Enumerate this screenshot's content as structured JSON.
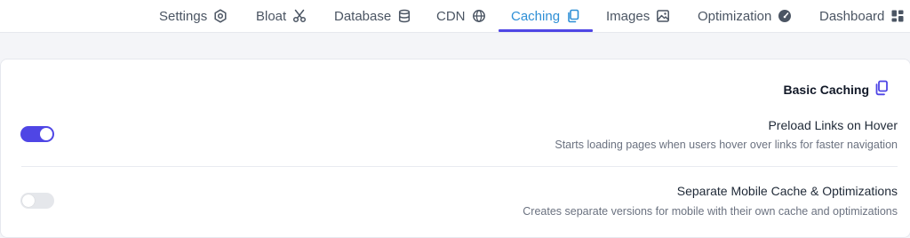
{
  "nav": {
    "tabs": [
      {
        "label": "Settings",
        "icon": "hexagon-settings-icon"
      },
      {
        "label": "Bloat",
        "icon": "scissors-icon"
      },
      {
        "label": "Database",
        "icon": "database-icon"
      },
      {
        "label": "CDN",
        "icon": "globe-icon"
      },
      {
        "label": "Caching",
        "icon": "copy-icon",
        "active": true
      },
      {
        "label": "Images",
        "icon": "image-icon"
      },
      {
        "label": "Optimization",
        "icon": "gauge-icon"
      },
      {
        "label": "Dashboard",
        "icon": "dashboard-grid-icon"
      }
    ],
    "active_color": "#2e8fd6",
    "underline_color": "#4f46e5"
  },
  "section": {
    "title": "Basic Caching",
    "icon": "copy-icon"
  },
  "options": [
    {
      "title": "Preload Links on Hover",
      "description": "Starts loading pages when users hover over links for faster navigation",
      "enabled": true
    },
    {
      "title": "Separate Mobile Cache & Optimizations",
      "description": "Creates separate versions for mobile with their own cache and optimizations",
      "enabled": false
    }
  ],
  "colors": {
    "accent": "#4f46e5",
    "toggle_off": "#e5e7eb"
  }
}
